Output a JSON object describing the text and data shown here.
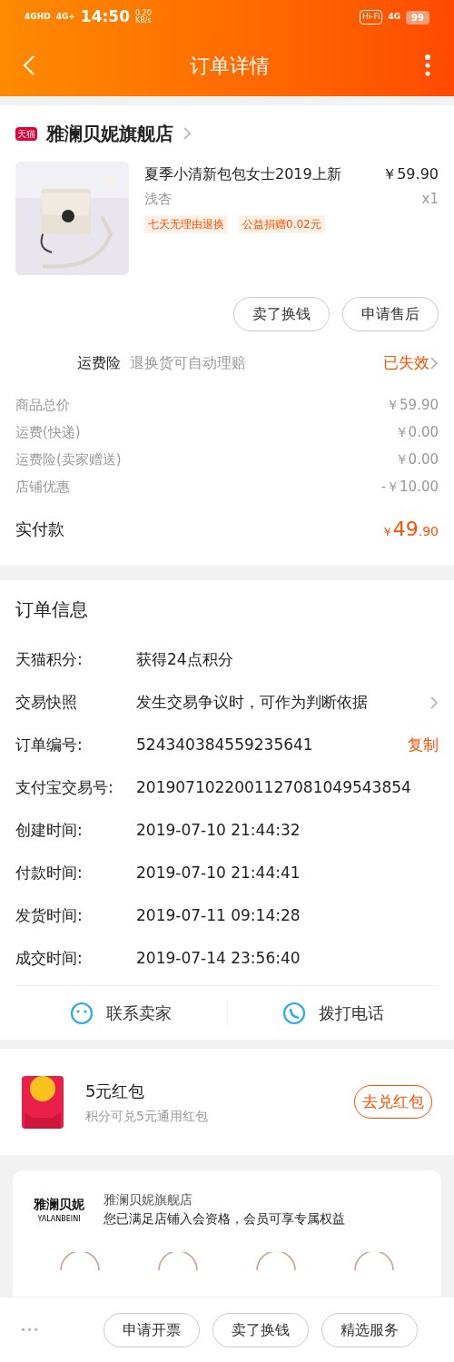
{
  "status_bar": {
    "signal_1": "4GHD",
    "signal_2": "4G+",
    "time": "14:50",
    "speed": "0.20",
    "speed_unit": "KB/s",
    "hifi": "Hi-Fi",
    "network": "4G",
    "battery": "99"
  },
  "header": {
    "title": "订单详情"
  },
  "store": {
    "badge": "天猫",
    "name": "雅澜贝妮旗舰店"
  },
  "product": {
    "title": "夏季小清新包包女士2019上新",
    "price": "￥59.90",
    "variant": "浅杏",
    "quantity": "x1",
    "tags": [
      "七天无理由退换",
      "公益捐赠0.02元"
    ]
  },
  "product_actions": [
    "卖了换钱",
    "申请售后"
  ],
  "insurance": {
    "label": "运费险",
    "description": "退换货可自动理赔",
    "status": "已失效"
  },
  "costs": [
    {
      "label": "商品总价",
      "value": "￥59.90"
    },
    {
      "label": "运费(快递)",
      "value": "￥0.00"
    },
    {
      "label": "运费险(卖家赠送)",
      "value": "￥0.00"
    },
    {
      "label": "店铺优惠",
      "value": "-￥10.00"
    }
  ],
  "total": {
    "label": "实付款",
    "currency": "￥",
    "integer": "49",
    "decimal": ".90"
  },
  "order_info": {
    "title": "订单信息",
    "rows": [
      {
        "kind": "plain",
        "label": "天猫积分:",
        "value": "获得24点积分"
      },
      {
        "kind": "link",
        "label": "交易快照",
        "value": "发生交易争议时，可作为判断依据"
      },
      {
        "kind": "copy",
        "label": "订单编号:",
        "value": "524340384559235641",
        "action": "复制"
      },
      {
        "kind": "plain",
        "label": "支付宝交易号:",
        "value": "2019071022001127081049543854"
      },
      {
        "kind": "plain",
        "label": "创建时间:",
        "value": "2019-07-10 21:44:32"
      },
      {
        "kind": "plain",
        "label": "付款时间:",
        "value": "2019-07-10 21:44:41"
      },
      {
        "kind": "plain",
        "label": "发货时间:",
        "value": "2019-07-11 09:14:28"
      },
      {
        "kind": "plain",
        "label": "成交时间:",
        "value": "2019-07-14 23:56:40"
      }
    ]
  },
  "contact": [
    {
      "kind": "chat",
      "label": "联系卖家"
    },
    {
      "kind": "phone",
      "label": "拨打电话"
    }
  ],
  "red_packet": {
    "title": "5元红包",
    "subtitle": "积分可兑5元通用红包",
    "button": "去兑红包"
  },
  "membership": {
    "logo": "雅澜贝妮",
    "logo_sub": "YALANBEINI",
    "store": "雅澜贝妮旗舰店",
    "message": "您已满足店铺入会资格，会员可享专属权益"
  },
  "bottom_bar": {
    "more": "•••",
    "buttons": [
      "申请开票",
      "卖了换钱",
      "精选服务"
    ]
  }
}
